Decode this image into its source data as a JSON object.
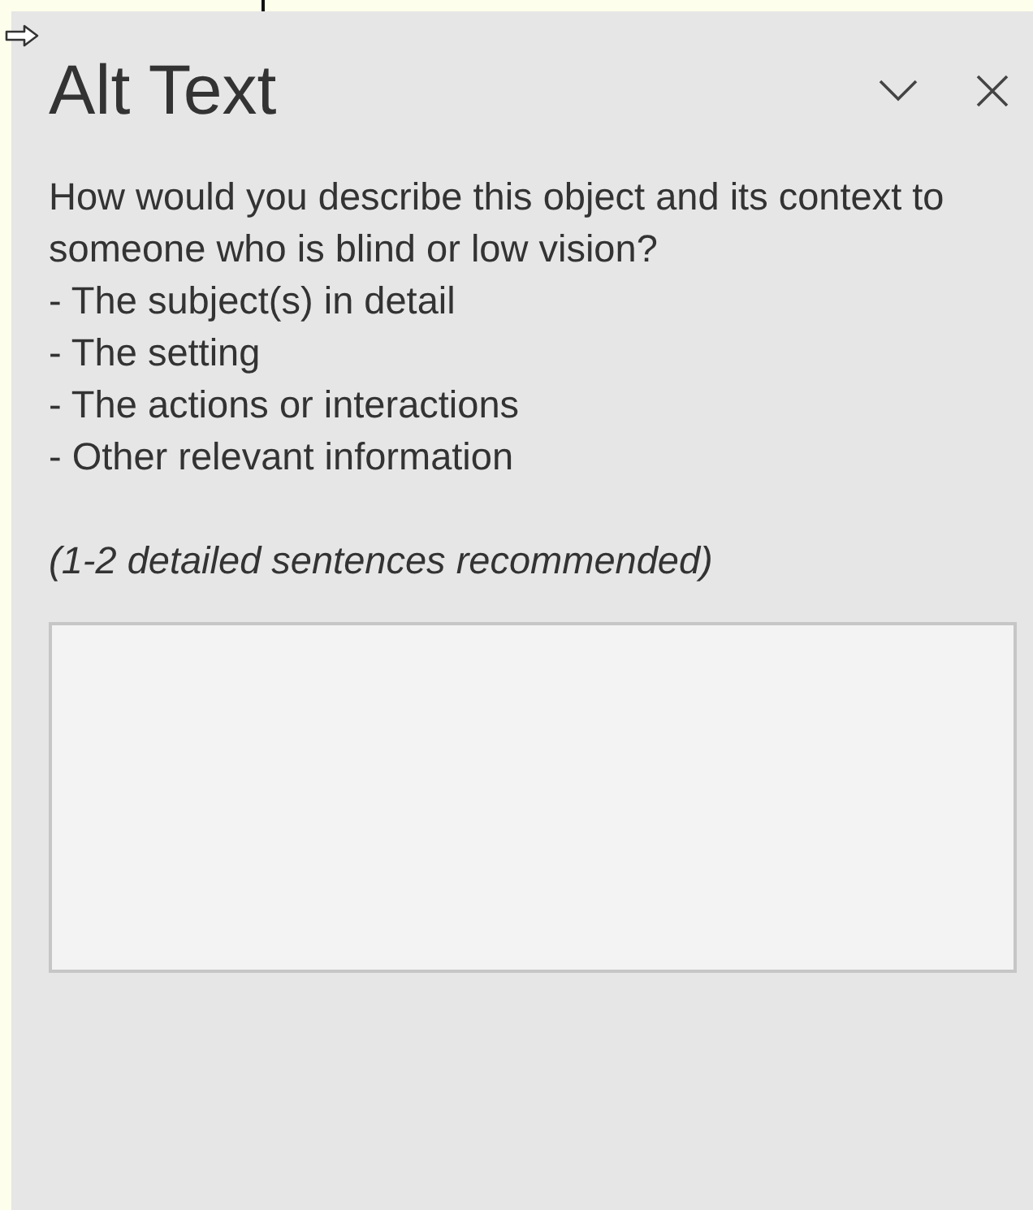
{
  "pane": {
    "title": "Alt Text",
    "prompt": "How would you describe this object and its context to someone who is blind or low vision?",
    "bullets": [
      "- The subject(s) in detail",
      "- The setting",
      "- The actions or interactions",
      "- Other relevant information"
    ],
    "hint": "(1-2 detailed sentences recommended)"
  }
}
